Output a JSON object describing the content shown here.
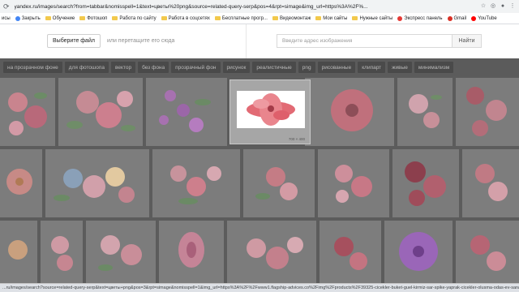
{
  "browser": {
    "url": "yandex.ru/images/search?from=tabbar&nomisspell=1&text=цветы%20png&source=related-query-serp&pos=4&rpt=simage&img_url=https%3A%2F%...",
    "bookmarks": [
      {
        "label": "исы",
        "icon": "none"
      },
      {
        "label": "Закрыть",
        "icon": "app-icon"
      },
      {
        "label": "Обучение",
        "icon": "folder-icon"
      },
      {
        "label": "Фотошоп",
        "icon": "folder-icon"
      },
      {
        "label": "Работа по сайту",
        "icon": "folder-icon"
      },
      {
        "label": "Работа в соцсетях",
        "icon": "folder-icon"
      },
      {
        "label": "Бесплатные прогр...",
        "icon": "folder-icon"
      },
      {
        "label": "Видеомонтаж",
        "icon": "folder-icon"
      },
      {
        "label": "Мои сайты",
        "icon": "folder-icon"
      },
      {
        "label": "Нужные сайты",
        "icon": "folder-icon"
      },
      {
        "label": "Экспресс панель",
        "icon": "express-icon"
      },
      {
        "label": "Gmail",
        "icon": "gmail-icon"
      },
      {
        "label": "YouTube",
        "icon": "youtube-icon"
      }
    ],
    "status_url": "...ru/images/search?source=related-query-serp&text=цветы+png&pos=3&rpt=simage&nomisspell=1&img_url=https%3A%2F%2Fwww1.flagship-advices.co%2Fimg%2Fproducts%2F39325-cicekler-buket-guel-kirmiz-sar-spike-yaprak-cicekler-olusma-odas-ev-sanat-dekor"
  },
  "upload": {
    "choose_file_label": "Выберите файл",
    "drag_hint": "или перетащите его сюда",
    "url_placeholder": "Введите адрес изображения",
    "find_label": "Найти"
  },
  "tags": [
    "на прозрачном фоне",
    "для фотошопа",
    "вектор",
    "без фона",
    "прозрачный фон",
    "рисунок",
    "реалистичные",
    "png",
    "рисованные",
    "клипарт",
    "живые",
    "минимализм"
  ],
  "hover_size": "700 × 400",
  "colors": {
    "accent_red": "#e06a72",
    "pink": "#efa6bd",
    "violet": "#a86fd0",
    "leaf": "#6f9b6a"
  }
}
